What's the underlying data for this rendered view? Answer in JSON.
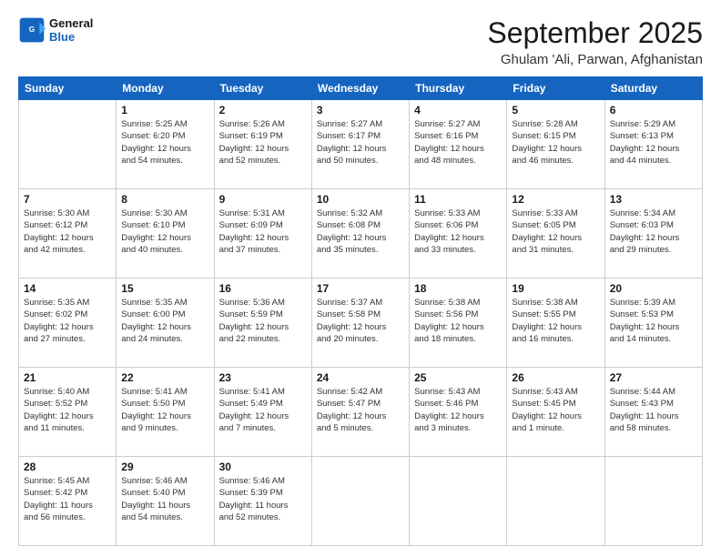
{
  "header": {
    "logo": {
      "line1": "General",
      "line2": "Blue"
    },
    "title": "September 2025",
    "location": "Ghulam 'Ali, Parwan, Afghanistan"
  },
  "days_of_week": [
    "Sunday",
    "Monday",
    "Tuesday",
    "Wednesday",
    "Thursday",
    "Friday",
    "Saturday"
  ],
  "weeks": [
    [
      {
        "day": "",
        "info": ""
      },
      {
        "day": "1",
        "info": "Sunrise: 5:25 AM\nSunset: 6:20 PM\nDaylight: 12 hours\nand 54 minutes."
      },
      {
        "day": "2",
        "info": "Sunrise: 5:26 AM\nSunset: 6:19 PM\nDaylight: 12 hours\nand 52 minutes."
      },
      {
        "day": "3",
        "info": "Sunrise: 5:27 AM\nSunset: 6:17 PM\nDaylight: 12 hours\nand 50 minutes."
      },
      {
        "day": "4",
        "info": "Sunrise: 5:27 AM\nSunset: 6:16 PM\nDaylight: 12 hours\nand 48 minutes."
      },
      {
        "day": "5",
        "info": "Sunrise: 5:28 AM\nSunset: 6:15 PM\nDaylight: 12 hours\nand 46 minutes."
      },
      {
        "day": "6",
        "info": "Sunrise: 5:29 AM\nSunset: 6:13 PM\nDaylight: 12 hours\nand 44 minutes."
      }
    ],
    [
      {
        "day": "7",
        "info": "Sunrise: 5:30 AM\nSunset: 6:12 PM\nDaylight: 12 hours\nand 42 minutes."
      },
      {
        "day": "8",
        "info": "Sunrise: 5:30 AM\nSunset: 6:10 PM\nDaylight: 12 hours\nand 40 minutes."
      },
      {
        "day": "9",
        "info": "Sunrise: 5:31 AM\nSunset: 6:09 PM\nDaylight: 12 hours\nand 37 minutes."
      },
      {
        "day": "10",
        "info": "Sunrise: 5:32 AM\nSunset: 6:08 PM\nDaylight: 12 hours\nand 35 minutes."
      },
      {
        "day": "11",
        "info": "Sunrise: 5:33 AM\nSunset: 6:06 PM\nDaylight: 12 hours\nand 33 minutes."
      },
      {
        "day": "12",
        "info": "Sunrise: 5:33 AM\nSunset: 6:05 PM\nDaylight: 12 hours\nand 31 minutes."
      },
      {
        "day": "13",
        "info": "Sunrise: 5:34 AM\nSunset: 6:03 PM\nDaylight: 12 hours\nand 29 minutes."
      }
    ],
    [
      {
        "day": "14",
        "info": "Sunrise: 5:35 AM\nSunset: 6:02 PM\nDaylight: 12 hours\nand 27 minutes."
      },
      {
        "day": "15",
        "info": "Sunrise: 5:35 AM\nSunset: 6:00 PM\nDaylight: 12 hours\nand 24 minutes."
      },
      {
        "day": "16",
        "info": "Sunrise: 5:36 AM\nSunset: 5:59 PM\nDaylight: 12 hours\nand 22 minutes."
      },
      {
        "day": "17",
        "info": "Sunrise: 5:37 AM\nSunset: 5:58 PM\nDaylight: 12 hours\nand 20 minutes."
      },
      {
        "day": "18",
        "info": "Sunrise: 5:38 AM\nSunset: 5:56 PM\nDaylight: 12 hours\nand 18 minutes."
      },
      {
        "day": "19",
        "info": "Sunrise: 5:38 AM\nSunset: 5:55 PM\nDaylight: 12 hours\nand 16 minutes."
      },
      {
        "day": "20",
        "info": "Sunrise: 5:39 AM\nSunset: 5:53 PM\nDaylight: 12 hours\nand 14 minutes."
      }
    ],
    [
      {
        "day": "21",
        "info": "Sunrise: 5:40 AM\nSunset: 5:52 PM\nDaylight: 12 hours\nand 11 minutes."
      },
      {
        "day": "22",
        "info": "Sunrise: 5:41 AM\nSunset: 5:50 PM\nDaylight: 12 hours\nand 9 minutes."
      },
      {
        "day": "23",
        "info": "Sunrise: 5:41 AM\nSunset: 5:49 PM\nDaylight: 12 hours\nand 7 minutes."
      },
      {
        "day": "24",
        "info": "Sunrise: 5:42 AM\nSunset: 5:47 PM\nDaylight: 12 hours\nand 5 minutes."
      },
      {
        "day": "25",
        "info": "Sunrise: 5:43 AM\nSunset: 5:46 PM\nDaylight: 12 hours\nand 3 minutes."
      },
      {
        "day": "26",
        "info": "Sunrise: 5:43 AM\nSunset: 5:45 PM\nDaylight: 12 hours\nand 1 minute."
      },
      {
        "day": "27",
        "info": "Sunrise: 5:44 AM\nSunset: 5:43 PM\nDaylight: 11 hours\nand 58 minutes."
      }
    ],
    [
      {
        "day": "28",
        "info": "Sunrise: 5:45 AM\nSunset: 5:42 PM\nDaylight: 11 hours\nand 56 minutes."
      },
      {
        "day": "29",
        "info": "Sunrise: 5:46 AM\nSunset: 5:40 PM\nDaylight: 11 hours\nand 54 minutes."
      },
      {
        "day": "30",
        "info": "Sunrise: 5:46 AM\nSunset: 5:39 PM\nDaylight: 11 hours\nand 52 minutes."
      },
      {
        "day": "",
        "info": ""
      },
      {
        "day": "",
        "info": ""
      },
      {
        "day": "",
        "info": ""
      },
      {
        "day": "",
        "info": ""
      }
    ]
  ]
}
